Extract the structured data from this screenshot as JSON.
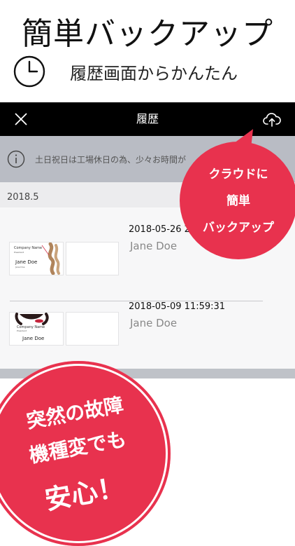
{
  "promo": {
    "title": "簡単バックアップ",
    "subtitle": "履歴画面からかんたん"
  },
  "navbar": {
    "close_icon": "close-icon",
    "title": "履歴",
    "cloud_icon": "cloud-upload-icon"
  },
  "notice": {
    "icon": "info-icon",
    "text": "土日祝日は工場休日の為、少々お時間が"
  },
  "history": {
    "section_date": "2018.5",
    "entries": [
      {
        "datetime": "2018-05-26 2",
        "name": "Jane Doe",
        "front": {
          "company": "Company Name",
          "title": "President",
          "name": "Jane Doe",
          "small": "Jane Doe"
        }
      },
      {
        "datetime": "2018-05-09 11:59:31",
        "name": "Jane Doe",
        "front": {
          "company": "Company Name",
          "title": "President",
          "name": "Jane Doe"
        }
      }
    ]
  },
  "callout_right": {
    "line1": "クラウドに",
    "line2": "簡単",
    "line3": "バックアップ"
  },
  "callout_left": {
    "line1": "突然の故障",
    "line2": "機種変でも",
    "line3": "安心！"
  },
  "colors": {
    "accent": "#e8324e",
    "navbar": "#000000",
    "notice_bg": "#b9bcc4"
  }
}
